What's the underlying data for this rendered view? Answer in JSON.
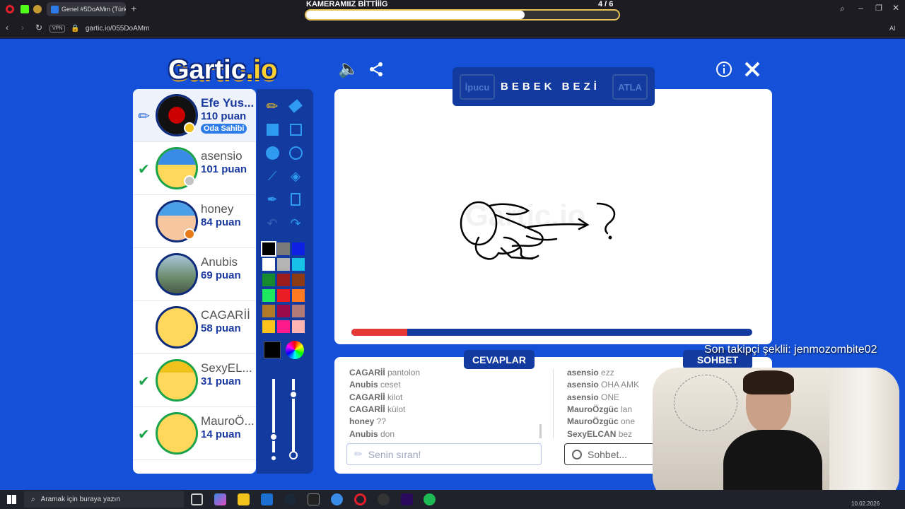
{
  "browser": {
    "tab_title": "Genel #5DoAMm (Türkçe",
    "url": "gartic.io/055DoAMm",
    "vpn_label": "VPN",
    "ai_label": "AI"
  },
  "overlay": {
    "title": "KAMERAMIIZ BİTTİİİG",
    "counter": "4 / 6",
    "progress": 0.7
  },
  "game": {
    "logo_main": "Gartic",
    "logo_suffix": ".io",
    "hint_label": "İpucu",
    "word": "BEBEK BEZİ",
    "skip_label": "ATLA",
    "watermark": "Gartic.io",
    "timer_progress": 0.14,
    "answers_title": "CEVAPLAR",
    "chat_title": "SOHBET",
    "answer_placeholder": "Senin sıran!",
    "chat_placeholder": "Sohbet...",
    "owner_badge": "Oda Sahibi",
    "accent": "#1551d8",
    "panel_color": "#123a9f"
  },
  "players": [
    {
      "name": "Efe Yus...",
      "points": "110 puan",
      "status": "drawing",
      "dot": "#f2c21c"
    },
    {
      "name": "asensio",
      "points": "101 puan",
      "status": "correct",
      "dot": "#c4c4c4"
    },
    {
      "name": "honey",
      "points": "84 puan",
      "status": "none",
      "dot": "#e87a1a"
    },
    {
      "name": "Anubis",
      "points": "69 puan",
      "status": "none",
      "dot": ""
    },
    {
      "name": "CAGARİİ",
      "points": "58 puan",
      "status": "none",
      "dot": ""
    },
    {
      "name": "SexyEL...",
      "points": "31 puan",
      "status": "correct",
      "dot": ""
    },
    {
      "name": "MauroÖ...",
      "points": "14 puan",
      "status": "correct",
      "dot": ""
    }
  ],
  "answers": [
    {
      "user": "CAGARİİ",
      "text": "pantolon"
    },
    {
      "user": "Anubis",
      "text": "ceset"
    },
    {
      "user": "CAGARİİ",
      "text": "kilot"
    },
    {
      "user": "CAGARİİ",
      "text": "külot"
    },
    {
      "user": "honey",
      "text": "??"
    },
    {
      "user": "Anubis",
      "text": "don"
    }
  ],
  "chat": [
    {
      "user": "asensio",
      "text": "ezz"
    },
    {
      "user": "asensio",
      "text": "OHA AMK"
    },
    {
      "user": "asensio",
      "text": "ONE"
    },
    {
      "user": "MauroÖzgüc",
      "text": "lan"
    },
    {
      "user": "MauroÖzgüc",
      "text": "one"
    },
    {
      "user": "SexyELCAN",
      "text": "bez"
    }
  ],
  "palette": [
    "#000000",
    "#7a7a7a",
    "#0d1fe0",
    "#ffffff",
    "#b4b4b4",
    "#18c0e8",
    "#158a2e",
    "#9b1c1c",
    "#8a3b14",
    "#1ee860",
    "#ec1c24",
    "#ff7a20",
    "#b07a28",
    "#9b0a4a",
    "#b07a78",
    "#ffc21c",
    "#ff1a8c",
    "#ffb4b4"
  ],
  "stream": {
    "follower_text": "Son takipçi şeklii: jenmozombite02"
  },
  "taskbar": {
    "search_placeholder": "Aramak için buraya yazın",
    "time": "10.02.2026"
  }
}
